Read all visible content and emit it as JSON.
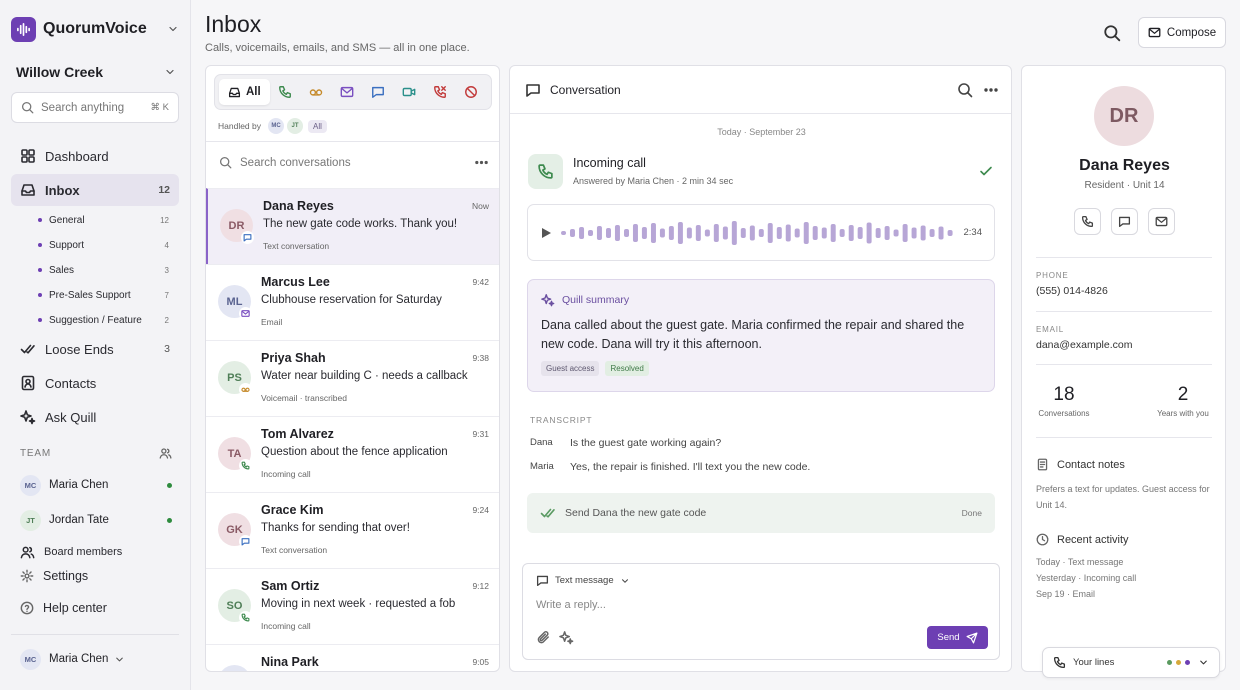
{
  "colors": {
    "accent": "#6d3fb3",
    "online": "#2e8b3e",
    "success": "#3d8a4e"
  },
  "brand": {
    "name": "QuorumVoice",
    "logo_icon": "waveform-icon"
  },
  "org": {
    "name": "Willow Creek"
  },
  "sidebar": {
    "search_placeholder": "Search anything",
    "search_shortcut": "⌘ K",
    "nav": {
      "dashboard": "Dashboard",
      "inbox": {
        "label": "Inbox",
        "count": "12"
      },
      "loose_ends": {
        "label": "Loose Ends",
        "count": "3"
      },
      "contacts": "Contacts",
      "ask_quill": "Ask Quill"
    },
    "inbox_subs": [
      {
        "label": "General",
        "count": "12"
      },
      {
        "label": "Support",
        "count": "4"
      },
      {
        "label": "Sales",
        "count": "3"
      },
      {
        "label": "Pre-Sales Support",
        "count": "7"
      },
      {
        "label": "Suggestion / Feature",
        "count": "2"
      }
    ],
    "team_header": "TEAM",
    "team": [
      {
        "initials": "MC",
        "name": "Maria Chen"
      },
      {
        "initials": "JT",
        "name": "Jordan Tate"
      }
    ],
    "board_members": "Board members",
    "settings": "Settings",
    "help": "Help center",
    "me": {
      "initials": "MC",
      "name": "Maria Chen"
    }
  },
  "header": {
    "title": "Inbox",
    "subtitle": "Calls, voicemails, emails, and SMS — all in one place.",
    "compose": "Compose"
  },
  "list": {
    "filter_all": "All",
    "handled_by": "Handled by",
    "handled_avatars": [
      "MC",
      "JT"
    ],
    "handled_all": "All",
    "search_placeholder": "Search conversations",
    "conversations": [
      {
        "initials": "DR",
        "name": "Dana Reyes",
        "time": "Now",
        "message": "The new gate code works. Thank you!",
        "type": "Text conversation",
        "badge": "sms",
        "avbg": "#f0dfe3",
        "avfg": "#8a5a65"
      },
      {
        "initials": "ML",
        "name": "Marcus Lee",
        "time": "9:42",
        "message": "Clubhouse reservation for Saturday",
        "type": "Email",
        "badge": "email",
        "avbg": "#e3e6f3",
        "avfg": "#5a6390"
      },
      {
        "initials": "PS",
        "name": "Priya Shah",
        "time": "9:38",
        "message": "Water near building C · needs a callback",
        "type": "Voicemail · transcribed",
        "badge": "voicemail",
        "avbg": "#e3eee4",
        "avfg": "#4f7e57"
      },
      {
        "initials": "TA",
        "name": "Tom Alvarez",
        "time": "9:31",
        "message": "Question about the fence application",
        "type": "Incoming call",
        "badge": "call",
        "avbg": "#f0dfe3",
        "avfg": "#8a5a65"
      },
      {
        "initials": "GK",
        "name": "Grace Kim",
        "time": "9:24",
        "message": "Thanks for sending that over!",
        "type": "Text conversation",
        "badge": "sms",
        "avbg": "#f0dfe3",
        "avfg": "#8a5a65"
      },
      {
        "initials": "SO",
        "name": "Sam Ortiz",
        "time": "9:12",
        "message": "Moving in next week · requested a fob",
        "type": "Incoming call",
        "badge": "call",
        "avbg": "#e3eee4",
        "avfg": "#4f7e57"
      },
      {
        "initials": "NP",
        "name": "Nina Park",
        "time": "9:05",
        "message": "",
        "type": "",
        "badge": "",
        "avbg": "#e3e6f3",
        "avfg": "#5a6390"
      }
    ]
  },
  "conversation": {
    "header": "Conversation",
    "date": "Today · September 23",
    "call_title": "Incoming call",
    "call_sub": "Answered by Maria Chen · 2 min 34 sec",
    "audio_duration": "2:34",
    "summary_title": "Quill summary",
    "summary_text": "Dana called about the guest gate. Maria confirmed the repair and shared the new code. Dana will try it this afternoon.",
    "tags": [
      "Guest access",
      "Resolved"
    ],
    "transcript_header": "TRANSCRIPT",
    "transcript": [
      {
        "speaker": "Dana",
        "text": "Is the guest gate working again?"
      },
      {
        "speaker": "Maria",
        "text": "Yes, the repair is finished. I'll text you the new code."
      }
    ],
    "task": "Send Dana the new gate code",
    "task_status": "Done",
    "composer_type": "Text message",
    "composer_placeholder": "Write a reply...",
    "send": "Send"
  },
  "contact": {
    "initials": "DR",
    "name": "Dana Reyes",
    "role": "Resident · Unit 14",
    "phone_label": "PHONE",
    "phone": "(555) 014-4826",
    "email_label": "EMAIL",
    "email": "dana@example.com",
    "conversations_count": "18",
    "conversations_label": "Conversations",
    "years": "2",
    "years_label": "Years with you",
    "notes_title": "Contact notes",
    "notes": "Prefers a text for updates. Guest access for Unit 14.",
    "activity_title": "Recent activity",
    "activity": [
      "Today · Text message",
      "Yesterday · Incoming call",
      "Sep 19 · Email"
    ]
  },
  "lines": {
    "label": "Your lines",
    "status_colors": [
      "#5a9a5f",
      "#d6a93a",
      "#6d3fb3"
    ]
  }
}
